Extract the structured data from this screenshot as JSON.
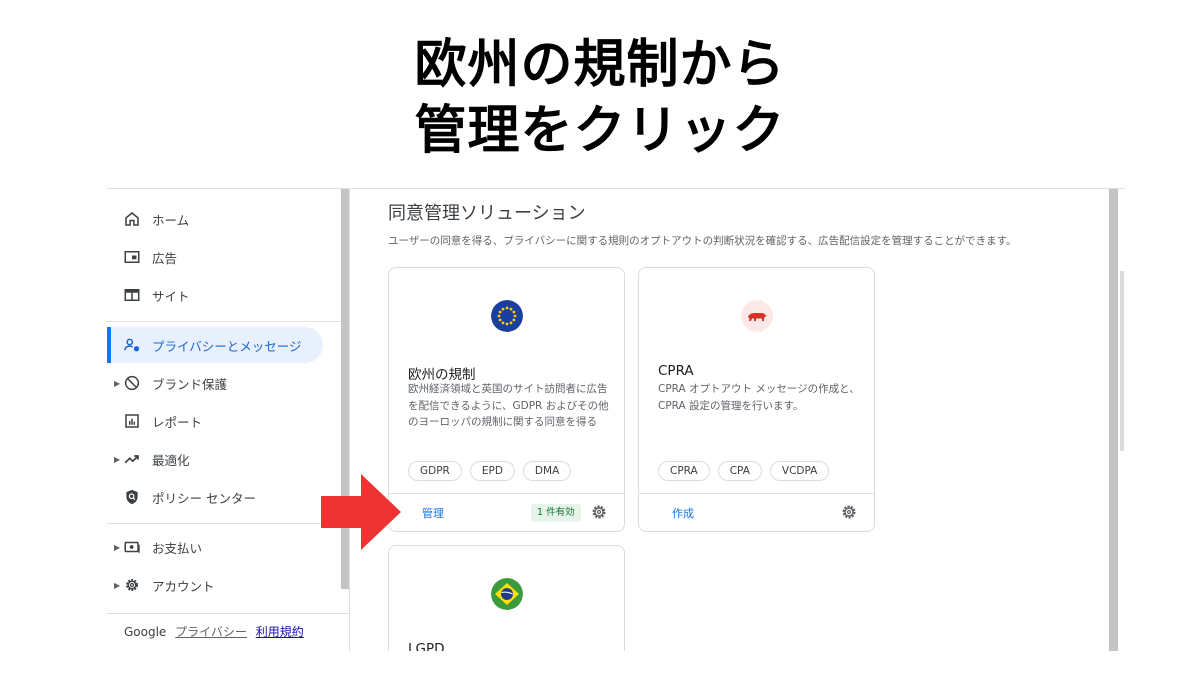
{
  "headline": {
    "line1": "欧州の規制から",
    "line2": "管理をクリック"
  },
  "sidebar": {
    "items": [
      {
        "label": "ホーム",
        "icon": "home-icon"
      },
      {
        "label": "広告",
        "icon": "ads-icon"
      },
      {
        "label": "サイト",
        "icon": "sites-icon"
      },
      {
        "label": "プライバシーとメッセージ",
        "icon": "privacy-icon",
        "active": true
      },
      {
        "label": "ブランド保護",
        "icon": "block-icon"
      },
      {
        "label": "レポート",
        "icon": "report-icon"
      },
      {
        "label": "最適化",
        "icon": "trending-icon"
      },
      {
        "label": "ポリシー センター",
        "icon": "policy-shield-icon"
      },
      {
        "label": "お支払い",
        "icon": "payment-icon"
      },
      {
        "label": "アカウント",
        "icon": "gear-icon"
      }
    ],
    "footer": {
      "brand": "Google",
      "privacy": "プライバシー",
      "terms": "利用規約"
    }
  },
  "main": {
    "title": "同意管理ソリューション",
    "description": "ユーザーの同意を得る、プライバシーに関する規則のオプトアウトの判断状況を確認する、広告配信設定を管理することができます。",
    "cards": [
      {
        "name": "欧州の規制",
        "description": "欧州経済領域と英国のサイト訪問者に広告を配信できるように、GDPR およびその他のヨーロッパの規制に関する同意を得る",
        "chips": [
          "GDPR",
          "EPD",
          "DMA"
        ],
        "action": "管理",
        "badge": "1 件有効",
        "logo": "eu-flag-icon"
      },
      {
        "name": "CPRA",
        "description": "CPRA オプトアウト メッセージの作成と、CPRA 設定の管理を行います。",
        "chips": [
          "CPRA",
          "CPA",
          "VCDPA"
        ],
        "action": "作成",
        "logo": "california-bear-icon"
      },
      {
        "name": "LGPD",
        "logo": "brazil-flag-icon"
      }
    ]
  },
  "colors": {
    "accent": "#1a73e8",
    "active_bg": "#e8f0fe",
    "badge_bg": "#e6f4ea",
    "arrow": "#ee3333"
  }
}
